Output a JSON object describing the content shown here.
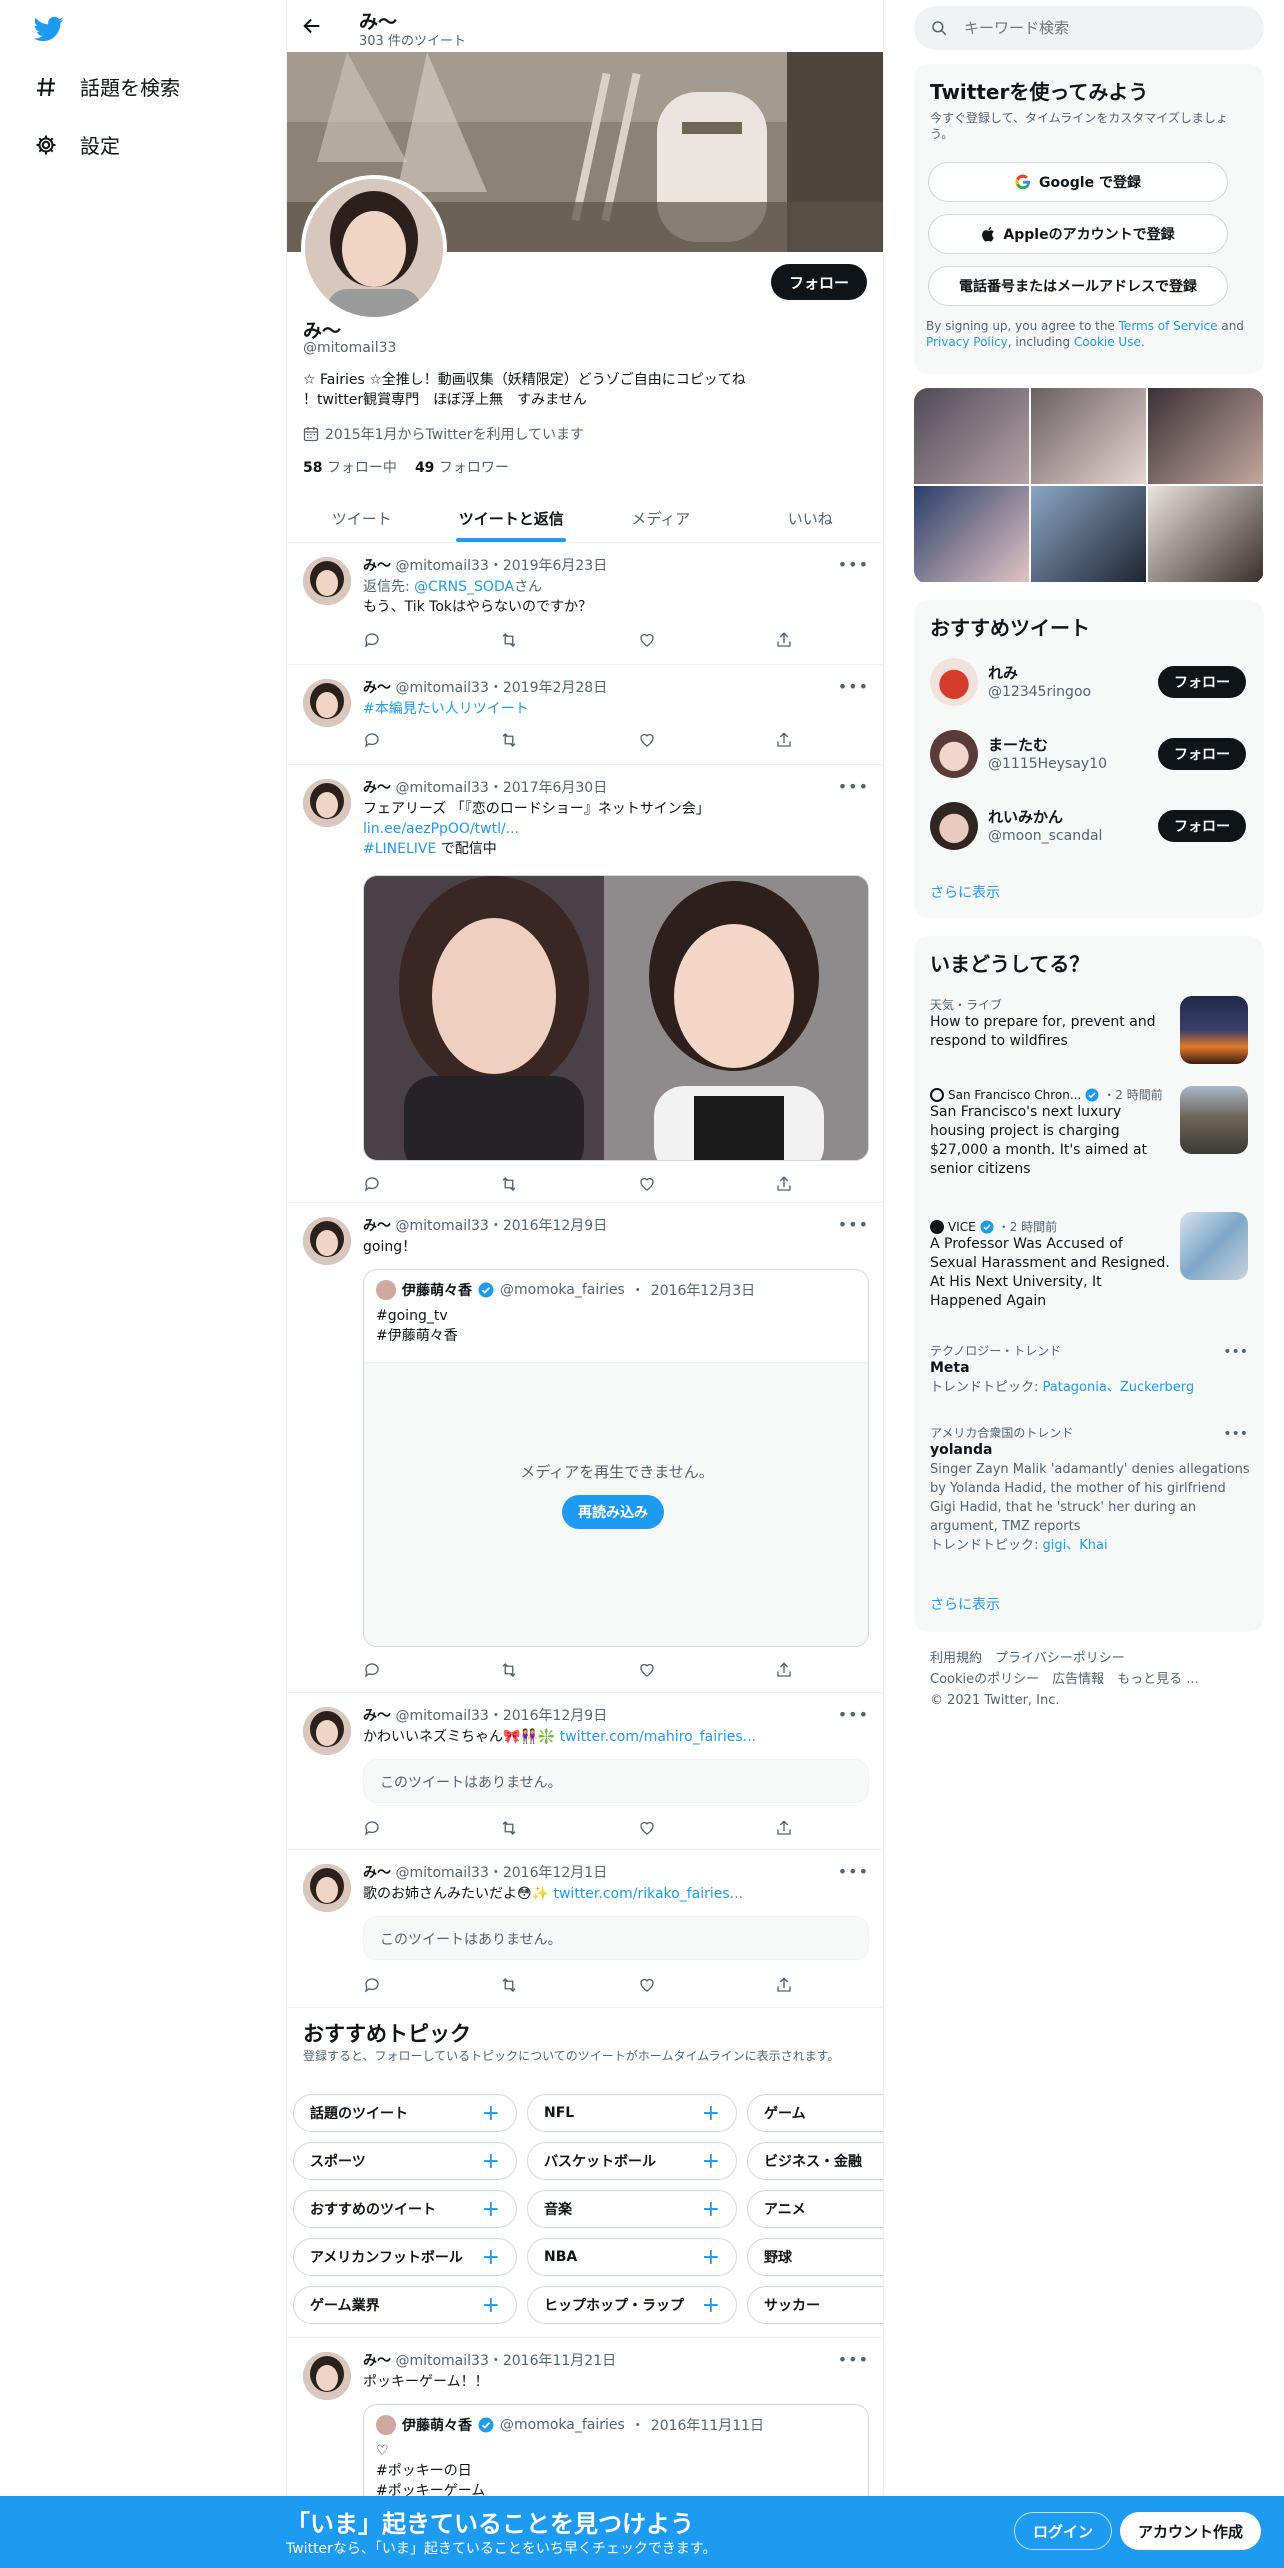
{
  "nav": {
    "explore": "話題を検索",
    "settings": "設定"
  },
  "header": {
    "name": "み～",
    "tweet_count": "303 件のツイート"
  },
  "profile": {
    "name": "み～",
    "handle": "@mitomail33",
    "follow_label": "フォロー",
    "bio_line1": "☆ Fairies ☆全推し！動画収集（妖精限定）どうゾご自由にコピッてね",
    "bio_line2": "！twitter観賞専門　ほぼ浮上無　すみません",
    "joined": "2015年1月からTwitterを利用しています",
    "following_count": "58",
    "following_label": "フォロー中",
    "followers_count": "49",
    "followers_label": "フォロワー"
  },
  "tabs": [
    "ツイート",
    "ツイートと返信",
    "メディア",
    "いいね"
  ],
  "tweets": [
    {
      "name": "み～",
      "handle": "@mitomail33",
      "date": "2019年6月23日",
      "reply_prefix": "返信先: ",
      "reply_to": "@CRNS_SODA",
      "reply_suffix": "さん",
      "text": "もう、Tik Tokはやらないのですか？"
    },
    {
      "name": "み～",
      "handle": "@mitomail33",
      "date": "2019年2月28日",
      "hashtag": "#本編見たい人リツイート"
    },
    {
      "name": "み～",
      "handle": "@mitomail33",
      "date": "2017年6月30日",
      "text": "フェアリーズ 「『恋のロードショー』ネットサイン会」",
      "link": "lin.ee/aezPpOO/twtl/...",
      "hashtag": "#LINELIVE",
      "suffix": " で配信中"
    },
    {
      "name": "み～",
      "handle": "@mitomail33",
      "date": "2016年12月9日",
      "text": "going！",
      "quote": {
        "name": "伊藤萌々香",
        "handle": "@momoka_fairies",
        "date": "2016年12月3日",
        "line1": "#going_tv",
        "line2": "#伊藤萌々香",
        "media_message": "メディアを再生できません。",
        "reload_label": "再読み込み"
      }
    },
    {
      "name": "み～",
      "handle": "@mitomail33",
      "date": "2016年12月9日",
      "text": "かわいいネズミちゃん🎀👭❇️ ",
      "link": "twitter.com/mahiro_fairies...",
      "unavailable": "このツイートはありません。"
    },
    {
      "name": "み～",
      "handle": "@mitomail33",
      "date": "2016年12月1日",
      "text": "歌のお姉さんみたいだよ😳✨ ",
      "link": "twitter.com/rikako_fairies...",
      "unavailable": "このツイートはありません。"
    },
    {
      "name": "み～",
      "handle": "@mitomail33",
      "date": "2016年11月21日",
      "text": "ポッキーゲーム！！",
      "quote": {
        "name": "伊藤萌々香",
        "handle": "@momoka_fairies",
        "date": "2016年11月11日",
        "line0": "♡",
        "line1": "#ポッキーの日",
        "line2": "#ポッキーゲーム"
      }
    }
  ],
  "topics": {
    "title": "おすすめトピック",
    "subtitle": "登録すると、フォローしているトピックについてのツイートがホームタイムラインに表示されます。",
    "rows": [
      [
        "話題のツイート",
        "NFL",
        "ゲーム"
      ],
      [
        "スポーツ",
        "バスケットボール",
        "ビジネス・金融"
      ],
      [
        "おすすめのツイート",
        "音楽",
        "アニメ"
      ],
      [
        "アメリカンフットボール",
        "NBA",
        "野球"
      ],
      [
        "ゲーム業界",
        "ヒップホップ・ラップ",
        "サッカー"
      ]
    ]
  },
  "search": {
    "placeholder": "キーワード検索"
  },
  "signup": {
    "title": "Twitterを使ってみよう",
    "desc": "今すぐ登録して、タイムラインをカスタマイズしましょう。",
    "google": "Google で登録",
    "apple": "Appleのアカウントで登録",
    "phone": "電話番号またはメールアドレスで登録",
    "terms_pre": "By signing up, you agree to the ",
    "terms_tos": "Terms of Service",
    "terms_and": " and ",
    "terms_pp": "Privacy Policy",
    "terms_inc": ", including ",
    "terms_cookie": "Cookie Use",
    "terms_end": "."
  },
  "recommended": {
    "title": "おすすめツイート",
    "follow_label": "フォロー",
    "users": [
      {
        "name": "れみ",
        "handle": "@12345ringoo"
      },
      {
        "name": "まーたむ",
        "handle": "@1115Heysay10"
      },
      {
        "name": "れいみかん",
        "handle": "@moon_scandal"
      }
    ],
    "more": "さらに表示"
  },
  "trends": {
    "title": "いまどうしてる？",
    "items": [
      {
        "category": "天気・ライブ",
        "headline": "How to prepare for, prevent and respond to wildfires"
      },
      {
        "source": "San Francisco Chron...",
        "time": "・2 時間前",
        "headline": "San Francisco's next luxury housing project is charging $27,000 a month. It's aimed at senior citizens"
      },
      {
        "source": "VICE",
        "time": "・2 時間前",
        "headline": "A Professor Was Accused of Sexual Harassment and Resigned. At His Next University, It Happened Again"
      },
      {
        "category": "テクノロジー・トレンド",
        "headline": "Meta",
        "related_label": "トレンドトピック: ",
        "related": "Patagonia、Zuckerberg"
      },
      {
        "category": "アメリカ合衆国のトレンド",
        "headline": "yolanda",
        "desc": "Singer Zayn Malik 'adamantly' denies allegations by Yolanda Hadid, the mother of his girlfriend Gigi Hadid, that he 'struck' her during an argument, TMZ reports",
        "related_label": "トレンドトピック: ",
        "related": "gigi、Khai"
      }
    ],
    "more": "さらに表示"
  },
  "footer": {
    "line1": "利用規約　プライバシーポリシー",
    "line2": "Cookieのポリシー　広告情報　もっと見る ...",
    "line3": "© 2021 Twitter, Inc."
  },
  "bottom_bar": {
    "title": "「いま」起きていることを見つけよう",
    "subtitle": "Twitterなら、「いま」起きていることをいち早くチェックできます。",
    "login": "ログイン",
    "signup": "アカウント作成"
  },
  "colors": {
    "accent": "#1d9bf0",
    "text": "#0f1419",
    "muted": "#536471"
  }
}
